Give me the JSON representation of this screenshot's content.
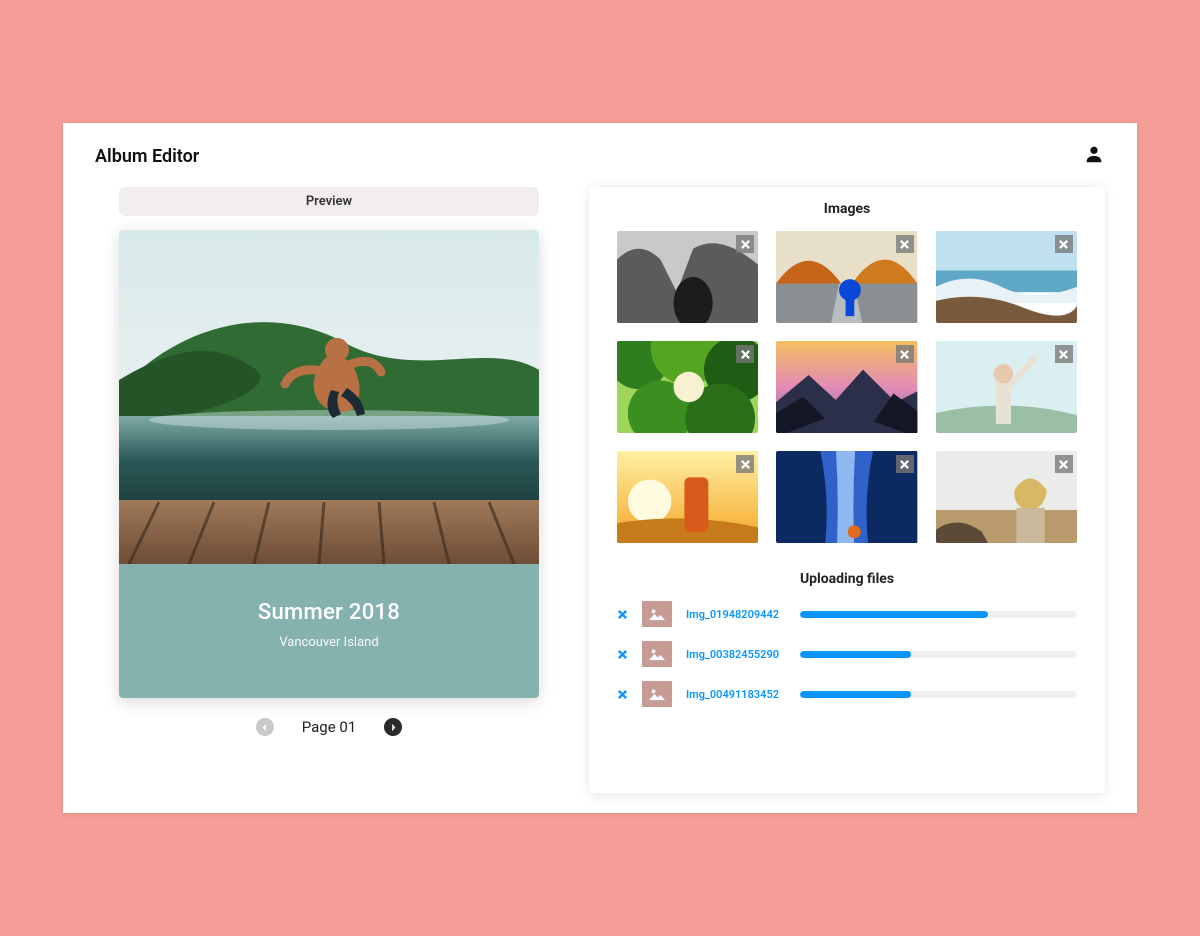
{
  "header": {
    "title": "Album Editor"
  },
  "preview": {
    "label": "Preview",
    "album_title": "Summer 2018",
    "album_subtitle": "Vancouver Island",
    "page_label": "Page 01"
  },
  "images_panel": {
    "title": "Images",
    "thumbs": [
      {
        "name": "canyon-bw"
      },
      {
        "name": "autumn-road"
      },
      {
        "name": "coast-wave"
      },
      {
        "name": "forest-canopy"
      },
      {
        "name": "mountain-sunset"
      },
      {
        "name": "celebration"
      },
      {
        "name": "desert-can"
      },
      {
        "name": "waterfall-blue"
      },
      {
        "name": "beach-portrait"
      }
    ]
  },
  "uploads": {
    "title": "Uploading files",
    "items": [
      {
        "filename": "Img_01948209442",
        "progress": 68
      },
      {
        "filename": "Img_00382455290",
        "progress": 40
      },
      {
        "filename": "Img_00491183452",
        "progress": 40
      }
    ]
  }
}
